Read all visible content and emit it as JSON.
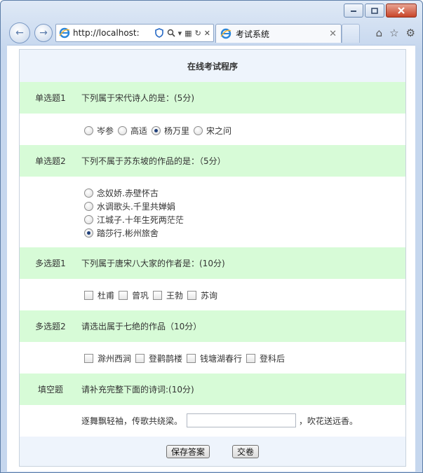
{
  "browser": {
    "address": "http://localhost:",
    "tab_title": "考试系统"
  },
  "page": {
    "title": "在线考试程序",
    "questions": [
      {
        "num": "单选题1",
        "text": "下列属于宋代诗人的是：(5分)",
        "options": [
          "岑参",
          "高适",
          "杨万里",
          "宋之问"
        ],
        "selected": "杨万里"
      },
      {
        "num": "单选题2",
        "text": "下列不属于苏东坡的作品的是：（5分）",
        "options": [
          "念奴娇.赤壁怀古",
          "水调歌头.千里共婵娟",
          "江城子.十年生死两茫茫",
          "踏莎行.彬州旅舍"
        ],
        "selected": "踏莎行.彬州旅舍"
      },
      {
        "num": "多选题1",
        "text": "下列属于唐宋八大家的作者是：(10分)",
        "options": [
          "杜甫",
          "曾巩",
          "王勃",
          "苏询"
        ]
      },
      {
        "num": "多选题2",
        "text": "请选出属于七绝的作品（10分）",
        "options": [
          "滁州西涧",
          "登鹳鹊楼",
          "钱塘湖春行",
          "登科后"
        ]
      },
      {
        "num": "填空题",
        "text": "请补充完整下面的诗词:(10分)",
        "prefix": "逐舞飘轻袖，传歌共绕梁。",
        "suffix": "，吹花送远香。",
        "value": ""
      }
    ],
    "save_label": "保存答案",
    "submit_label": "交卷"
  }
}
